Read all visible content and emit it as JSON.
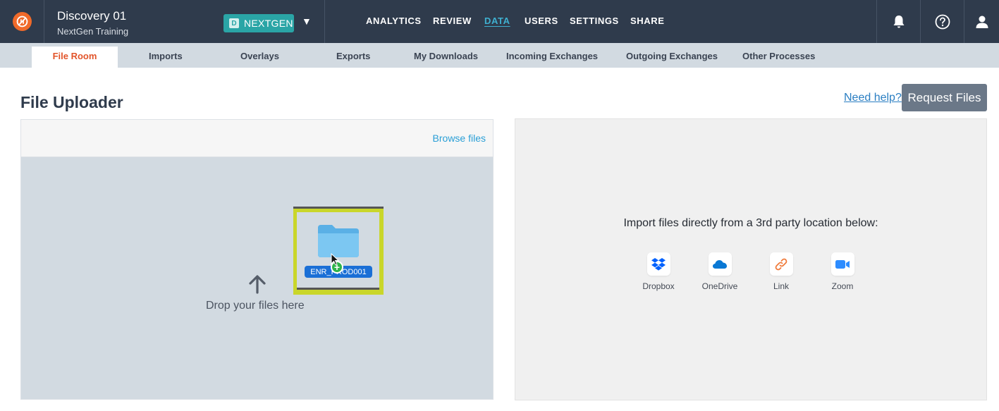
{
  "header": {
    "case_title": "Discovery 01",
    "case_subtitle": "NextGen Training",
    "workspace_letter": "D",
    "workspace_name": "NEXTGEN",
    "workspace_caret": "▼",
    "nav": [
      "ANALYTICS",
      "REVIEW",
      "DATA",
      "USERS",
      "SETTINGS",
      "SHARE"
    ],
    "active_nav": "DATA",
    "icons": [
      "bell-icon",
      "help-icon",
      "user-icon"
    ]
  },
  "subnav": {
    "tabs": [
      "File Room",
      "Imports",
      "Overlays",
      "Exports",
      "My Downloads",
      "Incoming Exchanges",
      "Outgoing Exchanges",
      "Other Processes"
    ],
    "active": "File Room"
  },
  "page": {
    "title": "File Uploader",
    "help_link": "Need help?",
    "request_button": "Request Files"
  },
  "uploader": {
    "browse_label": "Browse files",
    "drop_text": "Drop your files here",
    "dragged_folder": "ENR_PROD001"
  },
  "import": {
    "prompt": "Import files directly from a 3rd party location below:",
    "sources": [
      {
        "label": "Dropbox",
        "icon": "dropbox-icon",
        "color": "#0061fe"
      },
      {
        "label": "OneDrive",
        "icon": "onedrive-icon",
        "color": "#0a78d4"
      },
      {
        "label": "Link",
        "icon": "link-icon",
        "color": "#f07a3a"
      },
      {
        "label": "Zoom",
        "icon": "zoom-icon",
        "color": "#2d8cff"
      }
    ]
  },
  "colors": {
    "header_bg": "#2f3b4c",
    "brand_orange": "#f06a2a",
    "workspace_teal": "#2aa5a6",
    "active_tab": "#e2542a",
    "link_blue": "#2a7ec2"
  }
}
